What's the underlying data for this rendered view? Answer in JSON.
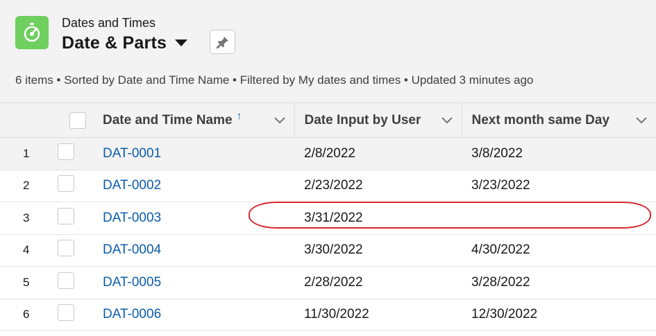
{
  "header": {
    "object_label": "Dates and Times",
    "view_title": "Date & Parts",
    "list_info": "6 items • Sorted by Date and Time Name • Filtered by My dates and times • Updated 3 minutes ago"
  },
  "icons": {
    "app": "stopwatch-icon",
    "pin": "pin-icon",
    "view_switch": "caret-down-icon",
    "sort": "arrow-up-icon",
    "column_menu": "chevron-down-icon"
  },
  "colors": {
    "app_icon_bg": "#6fcf5f",
    "link": "#0b5cab",
    "highlight": "#d9252b",
    "header_bg": "#f3f3f3"
  },
  "table": {
    "columns": [
      {
        "label": "Date and Time Name",
        "sort_indicator": "↑"
      },
      {
        "label": "Date Input by User"
      },
      {
        "label": "Next month same Day"
      }
    ],
    "rows": [
      {
        "num": "1",
        "name": "DAT-0001",
        "date_input": "2/8/2022",
        "next_month": "3/8/2022"
      },
      {
        "num": "2",
        "name": "DAT-0002",
        "date_input": "2/23/2022",
        "next_month": "3/23/2022"
      },
      {
        "num": "3",
        "name": "DAT-0003",
        "date_input": "3/31/2022",
        "next_month": ""
      },
      {
        "num": "4",
        "name": "DAT-0004",
        "date_input": "3/30/2022",
        "next_month": "4/30/2022"
      },
      {
        "num": "5",
        "name": "DAT-0005",
        "date_input": "2/28/2022",
        "next_month": "3/28/2022"
      },
      {
        "num": "6",
        "name": "DAT-0006",
        "date_input": "11/30/2022",
        "next_month": "12/30/2022"
      }
    ]
  }
}
